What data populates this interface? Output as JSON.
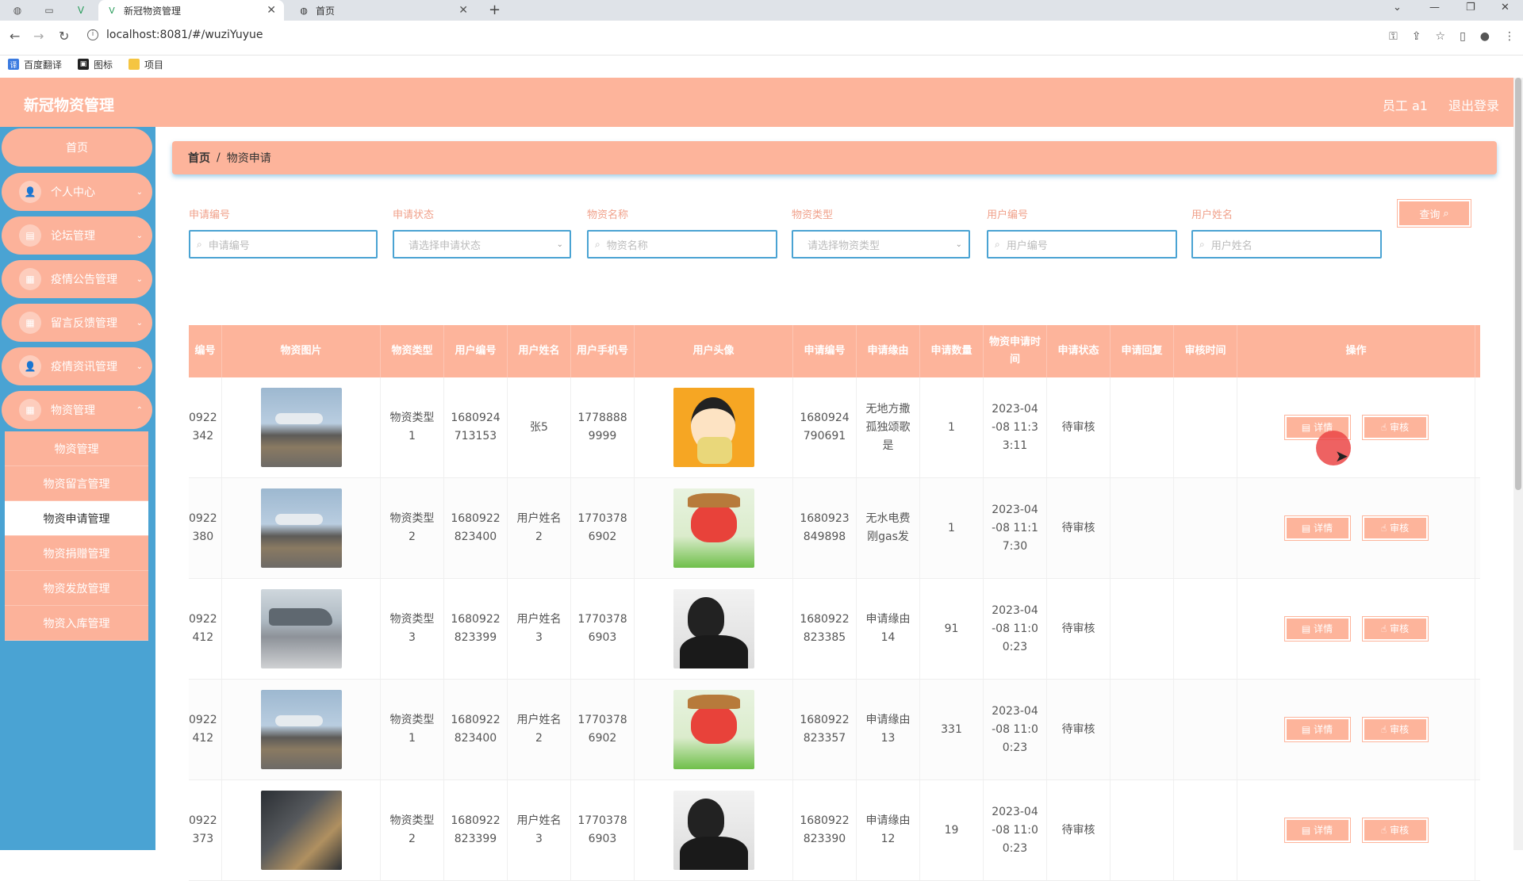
{
  "browser": {
    "tabs": [
      {
        "label": "新冠物资管理",
        "active": true
      },
      {
        "label": "首页",
        "active": false
      }
    ],
    "url": "localhost:8081/#/wuziYuyue",
    "bookmarks": [
      "百度翻译",
      "图标",
      "项目"
    ]
  },
  "header": {
    "title": "新冠物资管理",
    "user": "员工 a1",
    "logout": "退出登录"
  },
  "sidebar": {
    "home": "首页",
    "items": [
      {
        "label": "个人中心",
        "icon": "user-icon"
      },
      {
        "label": "论坛管理",
        "icon": "briefcase-icon"
      },
      {
        "label": "疫情公告管理",
        "icon": "grid-icon"
      },
      {
        "label": "留言反馈管理",
        "icon": "grid-icon"
      },
      {
        "label": "疫情资讯管理",
        "icon": "user-icon"
      },
      {
        "label": "物资管理",
        "icon": "grid-icon"
      }
    ],
    "submenu": [
      {
        "label": "物资管理",
        "active": false
      },
      {
        "label": "物资留言管理",
        "active": false
      },
      {
        "label": "物资申请管理",
        "active": true
      },
      {
        "label": "物资捐赠管理",
        "active": false
      },
      {
        "label": "物资发放管理",
        "active": false
      },
      {
        "label": "物资入库管理",
        "active": false
      }
    ]
  },
  "breadcrumb": {
    "home": "首页",
    "sep": "/",
    "current": "物资申请"
  },
  "filters": {
    "apply_no": {
      "label": "申请编号",
      "placeholder": "申请编号"
    },
    "status": {
      "label": "申请状态",
      "placeholder": "请选择申请状态"
    },
    "name": {
      "label": "物资名称",
      "placeholder": "物资名称"
    },
    "type": {
      "label": "物资类型",
      "placeholder": "请选择物资类型"
    },
    "user_no": {
      "label": "用户编号",
      "placeholder": "用户编号"
    },
    "user_name": {
      "label": "用户姓名",
      "placeholder": "用户姓名"
    },
    "search_label": "查询"
  },
  "table": {
    "headers": [
      "编号",
      "物资图片",
      "物资类型",
      "用户编号",
      "用户姓名",
      "用户手机号",
      "用户头像",
      "申请编号",
      "申请缘由",
      "申请数量",
      "物资申请时间",
      "申请状态",
      "申请回复",
      "审核时间",
      "操作"
    ],
    "detail_label": "详情",
    "audit_label": "审核",
    "rows": [
      {
        "no": "0922\n342",
        "img": "plane",
        "type": "物资类型\n1",
        "user_no": "1680924\n713153",
        "user_name": "张5",
        "phone": "1778888\n9999",
        "avatar": "crayon",
        "apply_no": "1680924\n790691",
        "reason": "无地方撒\n孤独颂歌\n是",
        "qty": "1",
        "time": "2023-04\n-08 11:3\n3:11",
        "status": "待审核",
        "reply": "",
        "audit_time": ""
      },
      {
        "no": "0922\n380",
        "img": "plane",
        "type": "物资类型\n2",
        "user_no": "1680922\n823400",
        "user_name": "用户姓名\n2",
        "phone": "1770378\n6902",
        "avatar": "fox",
        "apply_no": "1680923\n849898",
        "reason": "无水电费\n刚gas发",
        "qty": "1",
        "time": "2023-04\n-08 11:1\n7:30",
        "status": "待审核",
        "reply": "",
        "audit_time": ""
      },
      {
        "no": "0922\n412",
        "img": "plane2",
        "type": "物资类型\n3",
        "user_no": "1680922\n823399",
        "user_name": "用户姓名\n3",
        "phone": "1770378\n6903",
        "avatar": "man",
        "apply_no": "1680922\n823385",
        "reason": "申请缘由\n14",
        "qty": "91",
        "time": "2023-04\n-08 11:0\n0:23",
        "status": "待审核",
        "reply": "",
        "audit_time": ""
      },
      {
        "no": "0922\n412",
        "img": "plane",
        "type": "物资类型\n1",
        "user_no": "1680922\n823400",
        "user_name": "用户姓名\n2",
        "phone": "1770378\n6902",
        "avatar": "fox",
        "apply_no": "1680922\n823357",
        "reason": "申请缘由\n13",
        "qty": "331",
        "time": "2023-04\n-08 11:0\n0:23",
        "status": "待审核",
        "reply": "",
        "audit_time": ""
      },
      {
        "no": "0922\n373",
        "img": "boxes",
        "type": "物资类型\n2",
        "user_no": "1680922\n823399",
        "user_name": "用户姓名\n3",
        "phone": "1770378\n6903",
        "avatar": "man",
        "apply_no": "1680922\n823390",
        "reason": "申请缘由\n12",
        "qty": "19",
        "time": "2023-04\n-08 11:0\n0:23",
        "status": "待审核",
        "reply": "",
        "audit_time": ""
      }
    ]
  },
  "colors": {
    "accent": "#fdb49b",
    "sidebar": "#4aa3d3"
  }
}
